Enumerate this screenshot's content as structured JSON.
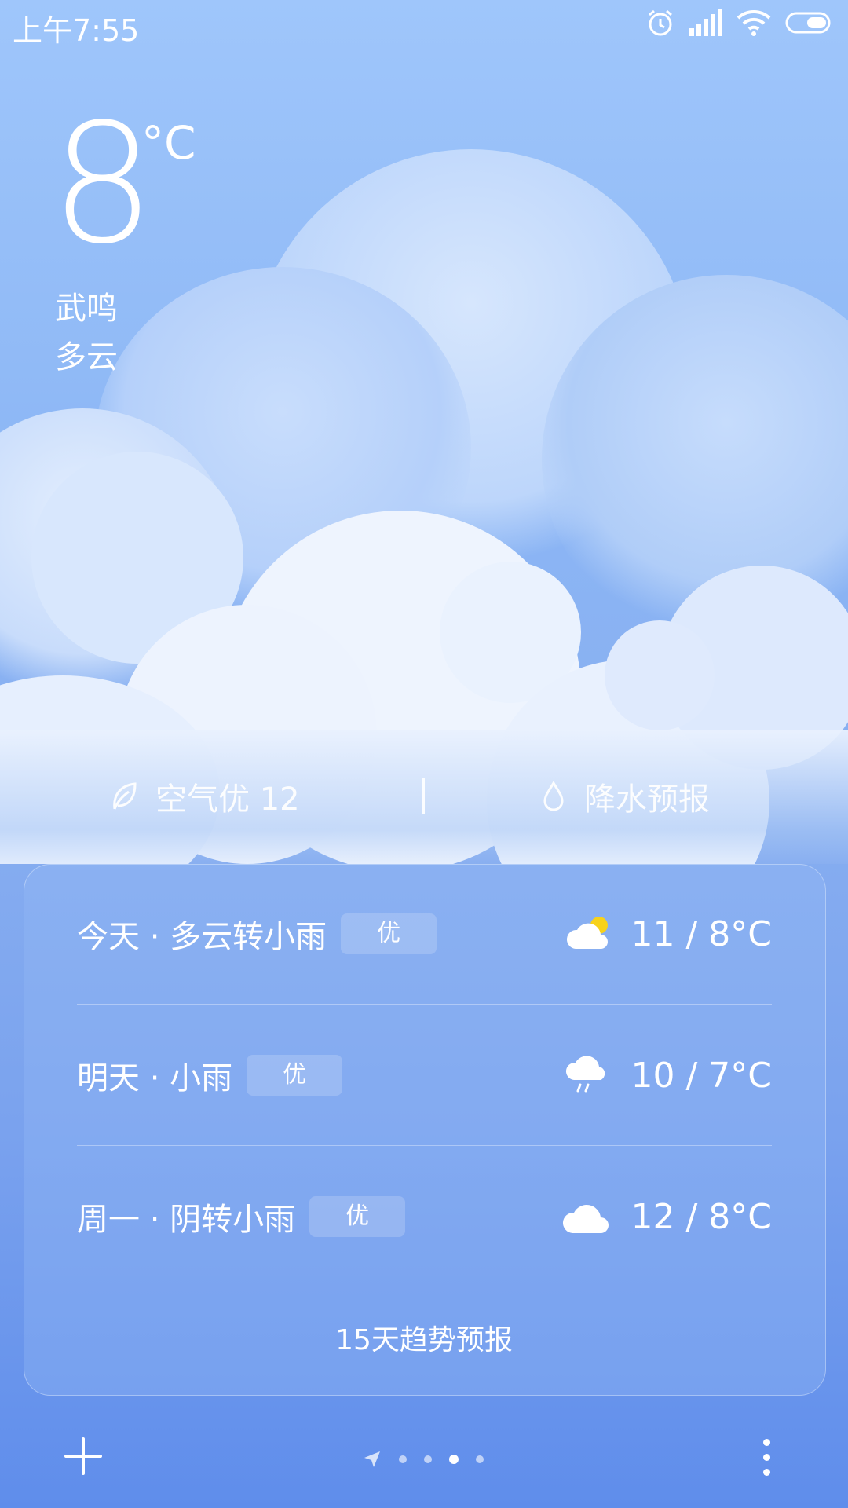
{
  "status_bar": {
    "time": "上午7:55",
    "icons": [
      "alarm-icon",
      "signal-icon",
      "wifi-icon",
      "battery-icon"
    ]
  },
  "current": {
    "temperature": "8",
    "unit": "°C",
    "city": "武鸣",
    "condition": "多云"
  },
  "info": {
    "air_quality": "空气优 12",
    "precipitation": "降水预报"
  },
  "forecast": [
    {
      "label": "今天 · 多云转小雨",
      "badge": "优",
      "icon": "partly-cloudy-sun-icon",
      "temps": "11 / 8°C"
    },
    {
      "label": "明天 · 小雨",
      "badge": "优",
      "icon": "light-rain-icon",
      "temps": "10 / 7°C"
    },
    {
      "label": "周一 · 阴转小雨",
      "badge": "优",
      "icon": "cloudy-icon",
      "temps": "12 / 8°C"
    }
  ],
  "trend_label": "15天趋势预报",
  "pager": {
    "count": 4,
    "active_index": 2
  },
  "colors": {
    "sun": "#f7d21b",
    "background_top": "#9fc6fb",
    "background_bottom": "#5f8deb"
  }
}
